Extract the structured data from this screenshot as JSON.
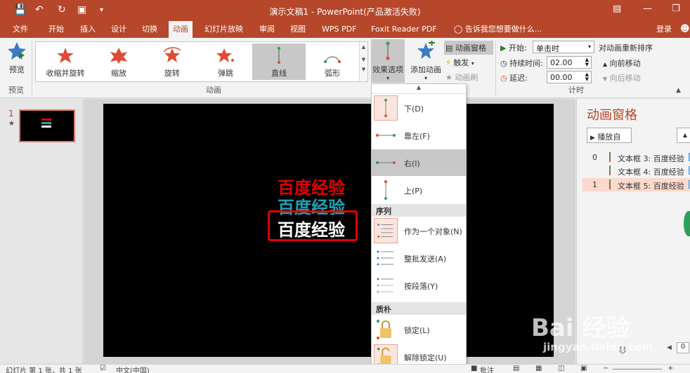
{
  "window": {
    "title": "演示文稿1 - PowerPoint(产品激活失败)",
    "sign_in": "登录"
  },
  "tabs": [
    "文件",
    "开始",
    "插入",
    "设计",
    "切换",
    "动画",
    "幻灯片放映",
    "审阅",
    "视图",
    "WPS PDF",
    "Foxit Reader PDF"
  ],
  "active_tab": "动画",
  "tell_me": "告诉我您想要做什么...",
  "ribbon": {
    "preview": {
      "label": "预览",
      "group": "预览"
    },
    "animations": {
      "group": "动画",
      "items": [
        "收缩并旋转",
        "缩放",
        "旋转",
        "弹跳",
        "直线",
        "弧形"
      ],
      "selected": "直线"
    },
    "effect_options": "效果选项",
    "advanced": {
      "add_animation": "添加动画",
      "animation_pane": "动画窗格",
      "trigger": "触发",
      "animation_painter": "动画刷"
    },
    "timing": {
      "group": "计时",
      "start_label": "开始:",
      "start_value": "单击时",
      "duration_label": "持续时间:",
      "duration_value": "02.00",
      "delay_label": "延迟:",
      "delay_value": "00.00",
      "reorder_title": "对动画重新排序",
      "move_earlier": "向前移动",
      "move_later": "向后移动"
    }
  },
  "slide_panel": {
    "number": "1",
    "star": "★"
  },
  "slide": {
    "texts": [
      {
        "text": "百度经验",
        "color": "#e00000"
      },
      {
        "text": "百度经验",
        "color": "#1aa3b8"
      },
      {
        "text": "百度经验",
        "color": "#ffffff"
      }
    ],
    "highlight_color": "#e00000"
  },
  "effect_menu": {
    "directions": [
      {
        "label": "下(D)"
      },
      {
        "label": "靠左(F)"
      },
      {
        "label": "右(I)"
      },
      {
        "label": "上(P)"
      }
    ],
    "selected_direction": "右(I)",
    "sequence_header": "序列",
    "sequence": [
      {
        "label": "作为一个对象(N)"
      },
      {
        "label": "整批发送(A)"
      },
      {
        "label": "按段落(Y)"
      }
    ],
    "lock_header": "质朴",
    "lock": [
      {
        "label": "锁定(L)"
      },
      {
        "label": "解除锁定(U)"
      }
    ]
  },
  "animation_pane": {
    "title": "动画窗格",
    "play": "播放自",
    "items": [
      {
        "num": "0",
        "text": "文本框 3: 百度经验"
      },
      {
        "num": "",
        "text": "文本框 4: 百度经验"
      },
      {
        "num": "1",
        "text": "文本框 5: 百度经验"
      }
    ],
    "seconds_label": "秒",
    "zoom_value": "0"
  },
  "statusbar": {
    "slide_info": "幻灯片 第 1 张，共 1 张",
    "language": "中文(中国)",
    "notes": "批注"
  },
  "watermark": {
    "brand": "Bai 经验",
    "url": "jingyan.baidu.com"
  },
  "colors": {
    "accent": "#b7472a",
    "selection": "#fbd9cc"
  }
}
